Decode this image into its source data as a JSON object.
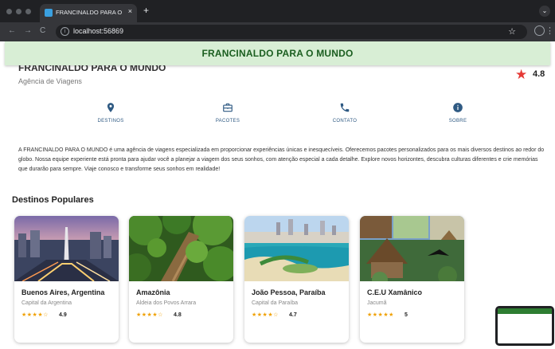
{
  "browser": {
    "tab_title": "FRANCINALDO PARA O MUNDO",
    "tab_close": "×",
    "new_tab": "+",
    "url": "localhost:56869",
    "back": "←",
    "forward": "→",
    "reload": "C"
  },
  "appbar": {
    "title": "FRANCINALDO PARA O MUNDO"
  },
  "agency": {
    "name": "FRANCINALDO PARA O MUNDO",
    "subtitle": "Agência de Viagens",
    "rating": "4.8"
  },
  "actions": [
    {
      "label": "DESTINOS",
      "icon": "location-pin-icon"
    },
    {
      "label": "PACOTES",
      "icon": "briefcase-icon"
    },
    {
      "label": "CONTATO",
      "icon": "phone-icon"
    },
    {
      "label": "SOBRE",
      "icon": "info-icon"
    }
  ],
  "description": "A FRANCINALDO PARA O MUNDO é uma agência de viagens especializada em proporcionar experiências únicas e inesquecíveis. Oferecemos pacotes personalizados para os mais diversos destinos ao redor do globo. Nossa equipe experiente está pronta para ajudar você a planejar a viagem dos seus sonhos, com atenção especial a cada detalhe. Explore novos horizontes, descubra culturas diferentes e crie memórias que durarão para sempre. Viaje conosco e transforme seus sonhos em realidade!",
  "section": {
    "title": "Destinos Populares"
  },
  "destinations": [
    {
      "title": "Buenos Aires, Argentina",
      "subtitle": "Capital da Argentina",
      "stars": "★★★★☆",
      "rating": "4.9"
    },
    {
      "title": "Amazônia",
      "subtitle": "Aldeia dos Povos Arrara",
      "stars": "★★★★☆",
      "rating": "4.8"
    },
    {
      "title": "João Pessoa, Paraíba",
      "subtitle": "Capital da Paraíba",
      "stars": "★★★★☆",
      "rating": "4.7"
    },
    {
      "title": "C.E.U Xamânico",
      "subtitle": "Jacumã",
      "stars": "★★★★★",
      "rating": "5"
    }
  ],
  "colors": {
    "appbar_bg": "#d8eed5",
    "appbar_text": "#1b5e20",
    "action_blue": "#2f5a83",
    "rating_star": "#e53935",
    "card_star": "#f0a000"
  }
}
